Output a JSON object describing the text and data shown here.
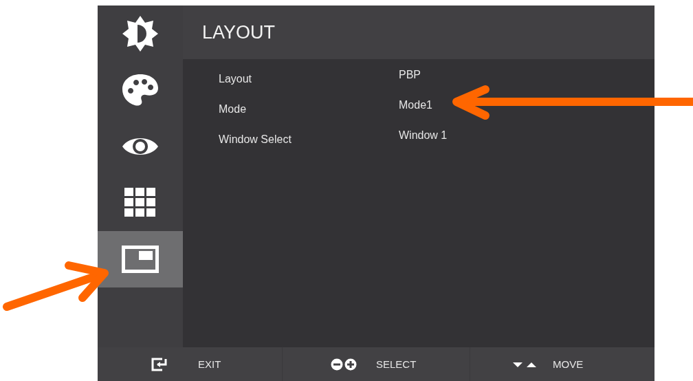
{
  "sidebar": {
    "items": [
      {
        "kind": "brightness",
        "selected": false
      },
      {
        "kind": "color",
        "selected": false
      },
      {
        "kind": "eye",
        "selected": false
      },
      {
        "kind": "grid",
        "selected": false
      },
      {
        "kind": "pip",
        "selected": true
      }
    ]
  },
  "header": {
    "title": "LAYOUT"
  },
  "settings": [
    {
      "label": "Layout",
      "value": "PBP"
    },
    {
      "label": "Mode",
      "value": "Mode1"
    },
    {
      "label": "Window Select",
      "value": "Window 1"
    }
  ],
  "footer": [
    {
      "kind": "exit",
      "label": "EXIT"
    },
    {
      "kind": "select",
      "label": "SELECT"
    },
    {
      "kind": "move",
      "label": "MOVE"
    }
  ]
}
